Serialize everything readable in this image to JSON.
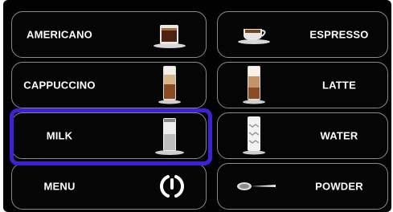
{
  "buttons_left": [
    {
      "label": "AMERICANO",
      "icon": "americano-cup-icon"
    },
    {
      "label": "CAPPUCCINO",
      "icon": "cappuccino-glass-icon"
    },
    {
      "label": "MILK",
      "icon": "milk-jug-icon"
    },
    {
      "label": "MENU",
      "icon": "menu-dial-icon"
    }
  ],
  "buttons_right": [
    {
      "label": "ESPRESSO",
      "icon": "espresso-cup-icon"
    },
    {
      "label": "LATTE",
      "icon": "latte-glass-icon"
    },
    {
      "label": "WATER",
      "icon": "water-glass-icon"
    },
    {
      "label": "POWDER",
      "icon": "powder-spoon-icon"
    }
  ],
  "selected": "MILK",
  "colors": {
    "screen_bg": "#020202",
    "button_border": "#8a8a8a",
    "selection_outline": "#3b22d6",
    "text": "#ffffff"
  }
}
